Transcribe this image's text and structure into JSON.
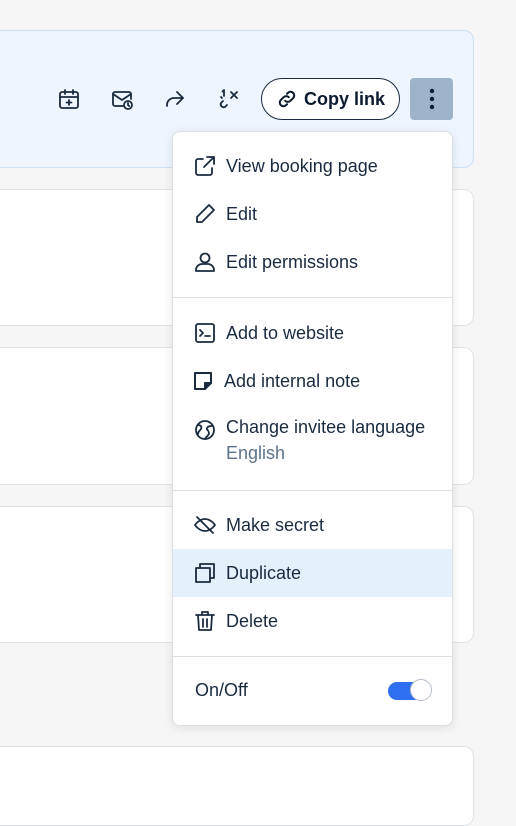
{
  "toolbar": {
    "icons": [
      "calendar-add-icon",
      "mail-clock-icon",
      "share-icon",
      "one-time-link-icon"
    ],
    "copy_link_label": "Copy link",
    "more_icon": "vertical-dots-icon"
  },
  "menu": {
    "group1": [
      {
        "label": "View booking page",
        "icon": "external-link-icon"
      },
      {
        "label": "Edit",
        "icon": "pencil-icon"
      },
      {
        "label": "Edit permissions",
        "icon": "person-icon"
      }
    ],
    "group2": [
      {
        "label": "Add to website",
        "icon": "code-window-icon"
      },
      {
        "label": "Add internal note",
        "icon": "sticky-note-icon"
      },
      {
        "label": "Change invitee language",
        "icon": "globe-icon",
        "sublabel": "English"
      }
    ],
    "group3": [
      {
        "label": "Make secret",
        "icon": "eye-off-icon"
      },
      {
        "label": "Duplicate",
        "icon": "copy-icon",
        "highlighted": true
      },
      {
        "label": "Delete",
        "icon": "trash-icon"
      }
    ],
    "toggle": {
      "label": "On/Off",
      "on": true
    }
  },
  "colors": {
    "accent": "#2f6ff2",
    "highlight": "#e5f0fd",
    "selected_card": "#eef5ff",
    "more_button": "#9cb3c9",
    "text": "#1a2b40",
    "muted": "#5d738c"
  }
}
